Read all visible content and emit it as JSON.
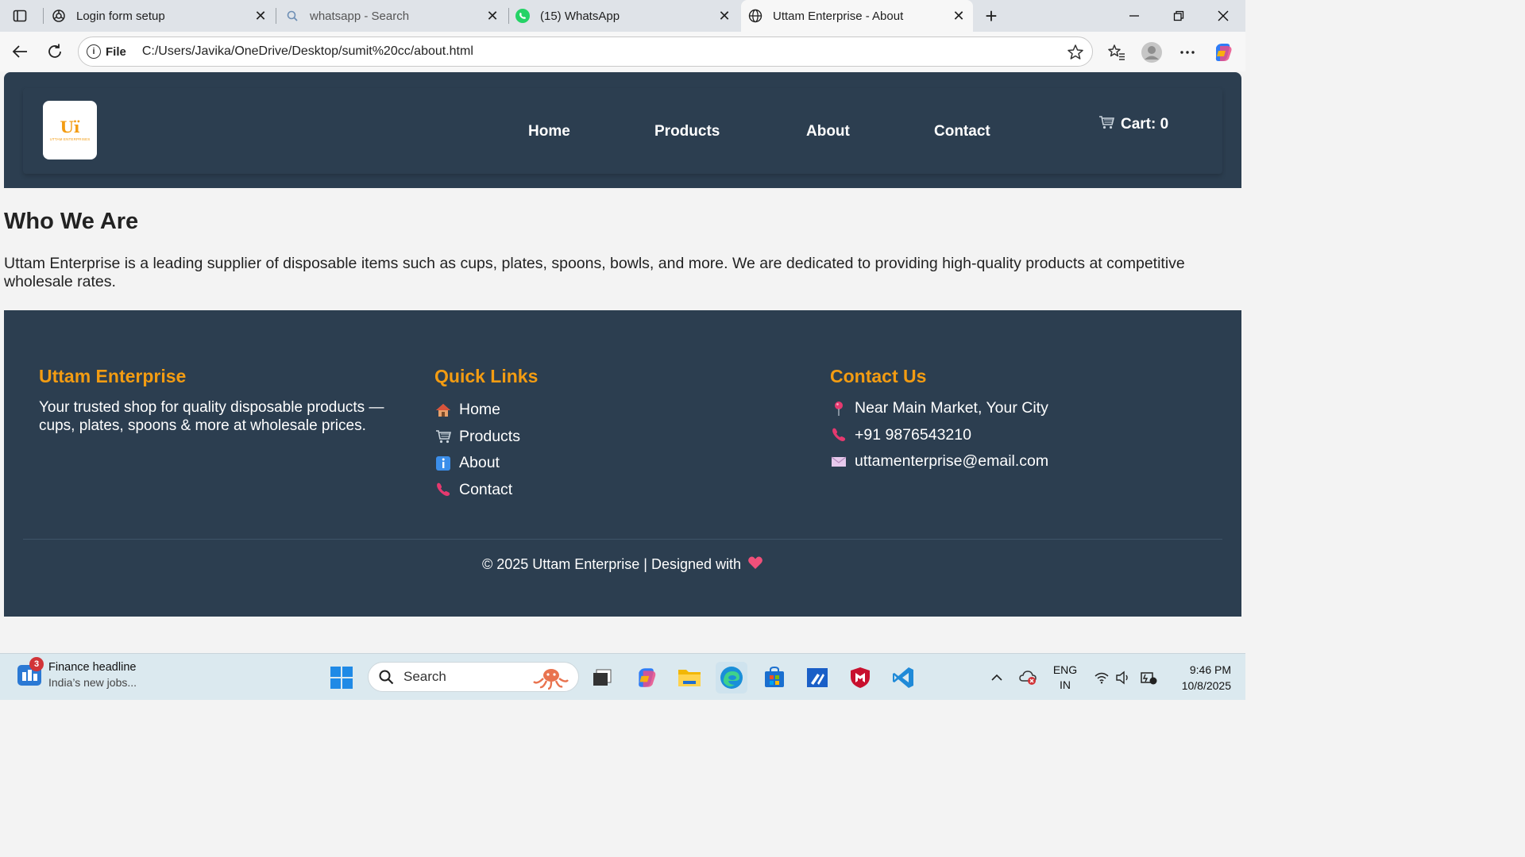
{
  "browser": {
    "tabs": [
      {
        "title": "Login form setup",
        "icon": "openai-icon"
      },
      {
        "title": "whatsapp - Search",
        "icon": "search-icon"
      },
      {
        "title": "(15) WhatsApp",
        "icon": "whatsapp-icon"
      },
      {
        "title": "Uttam Enterprise - About",
        "icon": "globe-icon",
        "active": true
      }
    ],
    "address": {
      "scheme": "File",
      "url": "C:/Users/Javika/OneDrive/Desktop/sumit%20cc/about.html"
    }
  },
  "site": {
    "logo": {
      "mark": "Uï",
      "text": "UTTAM ENTERPRISES"
    },
    "nav": [
      "Home",
      "Products",
      "About",
      "Contact"
    ],
    "cart_label": "Cart: 0",
    "about": {
      "title": "Who We Are",
      "text": "Uttam Enterprise is a leading supplier of disposable items such as cups, plates, spoons, bowls, and more. We are dedicated to providing high-quality products at competitive wholesale rates."
    },
    "footer": {
      "brand_heading": "Uttam Enterprise",
      "brand_text": "Your trusted shop for quality disposable products — cups, plates, spoons & more at wholesale prices.",
      "links_heading": "Quick Links",
      "links": [
        {
          "label": "Home",
          "icon": "house-icon"
        },
        {
          "label": "Products",
          "icon": "cart-icon"
        },
        {
          "label": "About",
          "icon": "info-icon"
        },
        {
          "label": "Contact",
          "icon": "phone-icon"
        }
      ],
      "contact_heading": "Contact Us",
      "contact": [
        {
          "label": "Near Main Market, Your City",
          "icon": "pin-icon"
        },
        {
          "label": "+91 9876543210",
          "icon": "phone-icon"
        },
        {
          "label": "uttamenterprise@email.com",
          "icon": "envelope-icon"
        }
      ],
      "copyright": "© 2025 Uttam Enterprise | Designed with"
    },
    "colors": {
      "header_bg": "#2c3e50",
      "accent": "#f39c12"
    }
  },
  "taskbar": {
    "news": {
      "badge": "3",
      "headline": "Finance headline",
      "sub": "India’s new jobs..."
    },
    "search_label": "Search",
    "lang": {
      "line1": "ENG",
      "line2": "IN"
    },
    "clock": {
      "time": "9:46 PM",
      "date": "10/8/2025"
    }
  }
}
